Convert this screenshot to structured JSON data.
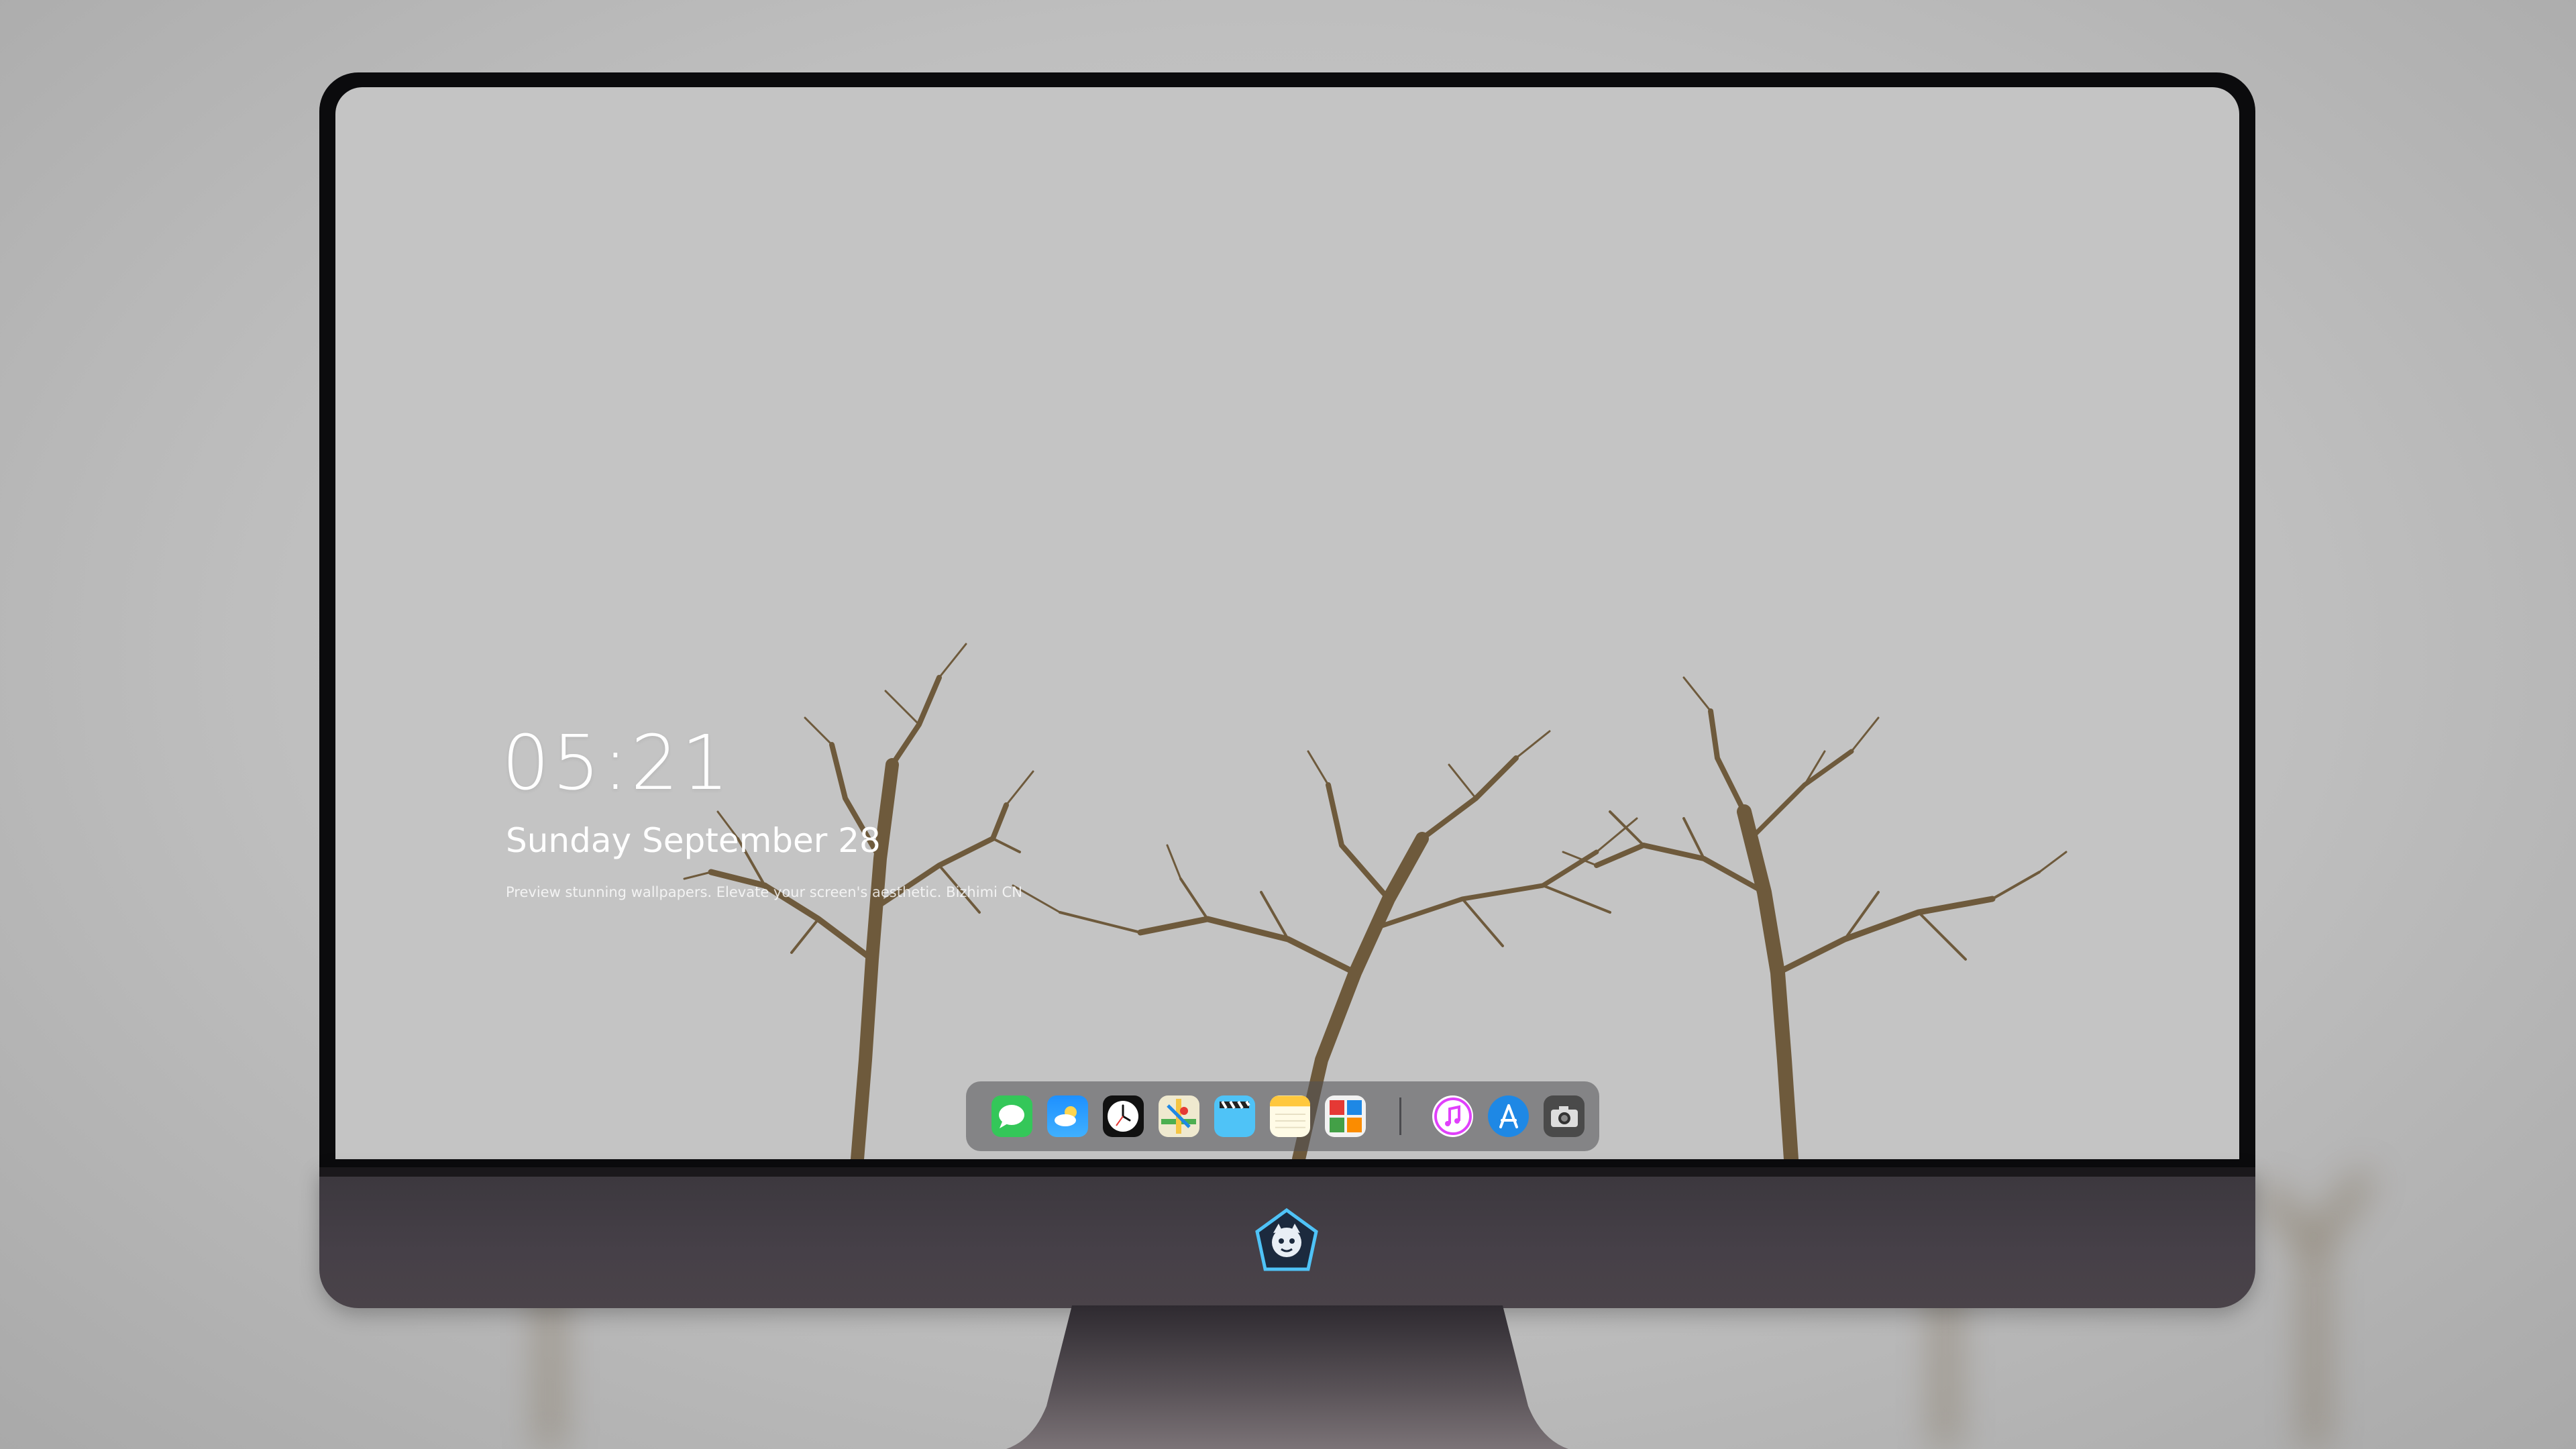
{
  "lockscreen": {
    "time": "05:21",
    "date": "Sunday September 28",
    "tagline": "Preview stunning wallpapers. Elevate your screen's aesthetic. Bizhimi CN"
  },
  "dock": {
    "apps": [
      {
        "icon": "messages-icon",
        "color": "#34c759"
      },
      {
        "icon": "weather-icon",
        "color": "#1e90ff"
      },
      {
        "icon": "clock-icon",
        "color": "#111111"
      },
      {
        "icon": "maps-icon",
        "color": "#e8e3c8"
      },
      {
        "icon": "video-clapper-icon",
        "color": "#4fc3f7"
      },
      {
        "icon": "notes-icon",
        "color": "#ffd54f"
      },
      {
        "icon": "photo-booth-icon",
        "color": "#f5f5f5"
      }
    ],
    "pinned": [
      {
        "icon": "music-icon",
        "color": "#e040fb"
      },
      {
        "icon": "app-store-icon",
        "color": "#1e88e5"
      },
      {
        "icon": "camera-icon",
        "color": "#4a4a4a"
      }
    ]
  },
  "colors": {
    "screen_bg": "#c4c4c4",
    "tree": "#6e5a3c",
    "chin": "#433e45"
  }
}
